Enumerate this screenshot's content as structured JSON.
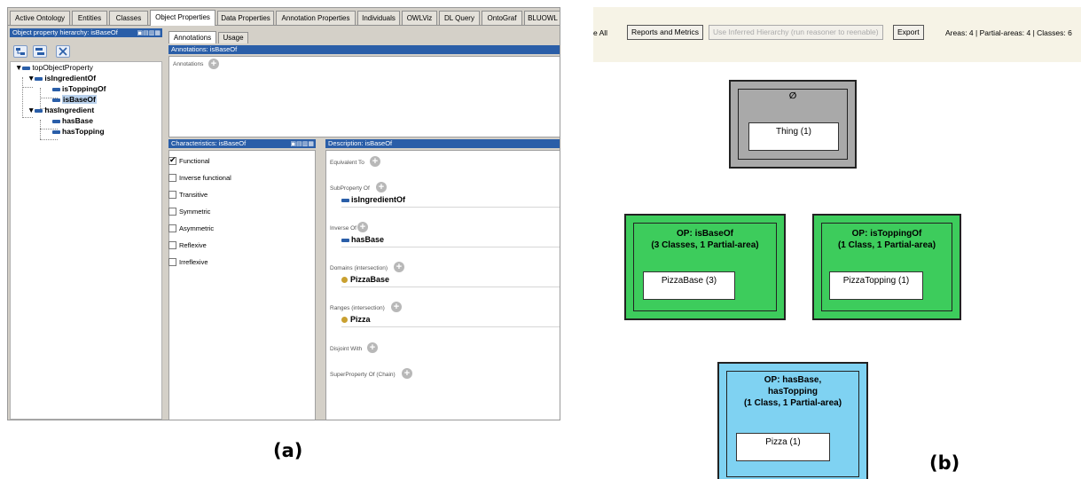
{
  "protege": {
    "tabs": [
      "Active Ontology",
      "Entities",
      "Classes",
      "Object Properties",
      "Data Properties",
      "Annotation Properties",
      "Individuals",
      "OWLViz",
      "DL Query",
      "OntoGraf",
      "BLUOWL"
    ],
    "active_tab": "Object Properties",
    "hierarchy": {
      "title": "Object property hierarchy: isBaseOf",
      "items": [
        {
          "label": "topObjectProperty",
          "selected": false
        },
        {
          "label": "isIngredientOf",
          "selected": false
        },
        {
          "label": "isToppingOf",
          "selected": false
        },
        {
          "label": "isBaseOf",
          "selected": true
        },
        {
          "label": "hasIngredient",
          "selected": false
        },
        {
          "label": "hasBase",
          "selected": false
        },
        {
          "label": "hasTopping",
          "selected": false
        }
      ]
    },
    "annotations": {
      "tabs": [
        "Annotations",
        "Usage"
      ],
      "title": "Annotations: isBaseOf",
      "label": "Annotations"
    },
    "characteristics": {
      "title": "Characteristics: isBaseOf",
      "items": [
        {
          "label": "Functional",
          "checked": true
        },
        {
          "label": "Inverse functional",
          "checked": false
        },
        {
          "label": "Transitive",
          "checked": false
        },
        {
          "label": "Symmetric",
          "checked": false
        },
        {
          "label": "Asymmetric",
          "checked": false
        },
        {
          "label": "Reflexive",
          "checked": false
        },
        {
          "label": "Irreflexive",
          "checked": false
        }
      ]
    },
    "description": {
      "title": "Description: isBaseOf",
      "equivalent_to": "Equivalent To",
      "subproperty_of": "SubProperty Of",
      "subproperty_value": "isIngredientOf",
      "inverse_of": "Inverse Of",
      "inverse_value": "hasBase",
      "domains": "Domains (intersection)",
      "domains_value": "PizzaBase",
      "ranges": "Ranges (intersection)",
      "ranges_value": "Pizza",
      "disjoint_with": "Disjoint With",
      "superproperty_chain": "SuperProperty Of (Chain)"
    },
    "caption": "(a)"
  },
  "taxonomy": {
    "toolbar": {
      "cut_label": "e All",
      "reports_label": "Reports and Metrics",
      "inferred_label": "Use Inferred Hierarchy (run reasoner to reenable)",
      "export_label": "Export",
      "summary": "Areas: 4 | Partial-areas: 4 | Classes: 6"
    },
    "areas": {
      "root": {
        "title": "∅",
        "class": "Thing (1)",
        "color": "#a9a9a9"
      },
      "isBaseOf": {
        "title_line1": "OP: isBaseOf",
        "title_line2": "(3 Classes, 1 Partial-area)",
        "class": "PizzaBase (3)",
        "color": "#3dcc5c"
      },
      "isToppingOf": {
        "title_line1": "OP: isToppingOf",
        "title_line2": "(1 Class, 1 Partial-area)",
        "class": "PizzaTopping (1)",
        "color": "#3dcc5c"
      },
      "hasBaseTopping": {
        "title_line1": "OP: hasBase,",
        "title_line2": "hasTopping",
        "title_line3": "(1 Class, 1 Partial-area)",
        "class": "Pizza (1)",
        "color": "#7fd2f2"
      }
    },
    "caption": "(b)"
  }
}
